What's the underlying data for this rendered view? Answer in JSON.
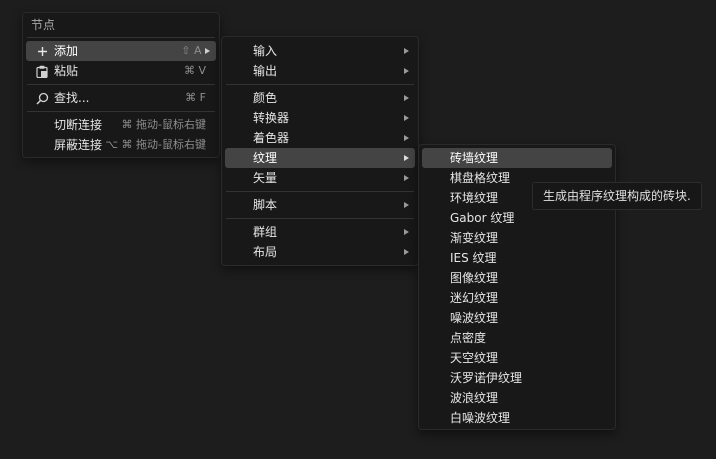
{
  "node_menu": {
    "title": "节点",
    "items": [
      {
        "label": "添加",
        "shortcut": "⇧ A",
        "icon": "plus-icon",
        "highlighted": true,
        "submenu": true
      },
      {
        "label": "粘贴",
        "shortcut": "⌘ V",
        "icon": "clipboard-icon"
      },
      {
        "label": "查找...",
        "shortcut": "⌘ F",
        "icon": "search-icon"
      },
      {
        "label": "切断连接",
        "shortcut": "⌘ 拖动-鼠标右键"
      },
      {
        "label": "屏蔽连接",
        "shortcut": "⌥ ⌘ 拖动-鼠标右键"
      }
    ]
  },
  "add_menu": {
    "items": [
      {
        "label": "输入"
      },
      {
        "label": "输出"
      },
      {
        "label": "颜色"
      },
      {
        "label": "转换器"
      },
      {
        "label": "着色器"
      },
      {
        "label": "纹理",
        "highlighted": true
      },
      {
        "label": "矢量"
      },
      {
        "label": "脚本"
      },
      {
        "label": "群组"
      },
      {
        "label": "布局"
      }
    ]
  },
  "texture_menu": {
    "items": [
      {
        "label": "砖墙纹理",
        "highlighted": true
      },
      {
        "label": "棋盘格纹理"
      },
      {
        "label": "环境纹理"
      },
      {
        "label": "Gabor 纹理"
      },
      {
        "label": "渐变纹理"
      },
      {
        "label": "IES 纹理"
      },
      {
        "label": "图像纹理"
      },
      {
        "label": "迷幻纹理"
      },
      {
        "label": "噪波纹理"
      },
      {
        "label": "点密度"
      },
      {
        "label": "天空纹理"
      },
      {
        "label": "沃罗诺伊纹理"
      },
      {
        "label": "波浪纹理"
      },
      {
        "label": "白噪波纹理"
      }
    ]
  },
  "tooltip": {
    "text": "生成由程序纹理构成的砖块."
  },
  "colors": {
    "background": "#1d1d1d",
    "menu_bg": "#181818",
    "highlight": "#444444"
  }
}
